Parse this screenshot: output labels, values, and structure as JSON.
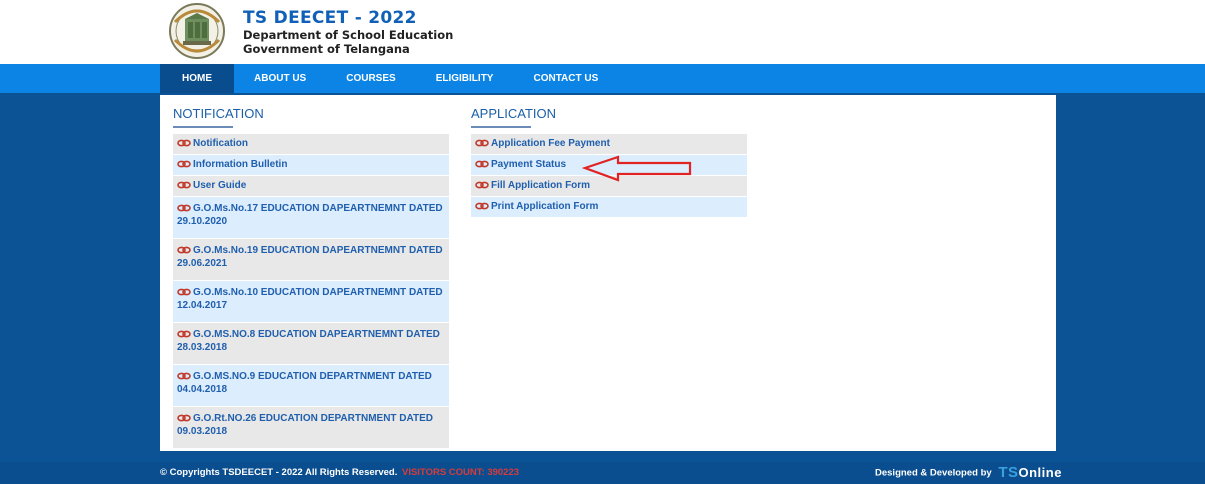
{
  "header": {
    "title": "TS DEECET - 2022",
    "line1": "Department of School Education",
    "line2": "Government of Telangana"
  },
  "nav": {
    "items": [
      {
        "label": "HOME"
      },
      {
        "label": "ABOUT US"
      },
      {
        "label": "COURSES"
      },
      {
        "label": "ELIGIBILITY"
      },
      {
        "label": "CONTACT US"
      }
    ]
  },
  "notification": {
    "title": "NOTIFICATION",
    "items": [
      {
        "line1": "Notification",
        "line2": ""
      },
      {
        "line1": "Information Bulletin",
        "line2": ""
      },
      {
        "line1": "User Guide",
        "line2": ""
      },
      {
        "line1": "G.O.Ms.No.17 EDUCATION DAPEARTNEMNT DATED",
        "line2": "29.10.2020"
      },
      {
        "line1": "G.O.Ms.No.19 EDUCATION DAPEARTNEMNT DATED",
        "line2": "29.06.2021"
      },
      {
        "line1": "G.O.Ms.No.10 EDUCATION DAPEARTNEMNT DATED",
        "line2": "12.04.2017"
      },
      {
        "line1": "G.O.MS.NO.8 EDUCATION DAPEARTNEMNT DATED",
        "line2": "28.03.2018"
      },
      {
        "line1": "G.O.MS.NO.9 EDUCATION DEPARTNMENT DATED",
        "line2": "04.04.2018"
      },
      {
        "line1": "G.O.Rt.NO.26 EDUCATION DEPARTNMENT DATED",
        "line2": "09.03.2018"
      }
    ]
  },
  "application": {
    "title": "APPLICATION",
    "items": [
      {
        "label": "Application Fee Payment"
      },
      {
        "label": "Payment Status"
      },
      {
        "label": "Fill Application Form"
      },
      {
        "label": "Print Application Form"
      }
    ]
  },
  "footer": {
    "copyright": "© Copyrights TSDEECET - 2022 All Rights Reserved.",
    "visitors": "VISITORS COUNT: 390223",
    "designed": "Designed & Developed by",
    "brand_t": "TS",
    "brand_rest": "Online"
  },
  "colors": {
    "nav_bg": "#0b84e6",
    "nav_active": "#0a4d8f",
    "page_bg": "#0b5394",
    "link": "#1f5fae",
    "arrow": "#e02424"
  },
  "icons": {
    "link": "chain-link-icon",
    "emblem": "telangana-emblem-logo",
    "arrow": "red-outline-arrow-left"
  }
}
